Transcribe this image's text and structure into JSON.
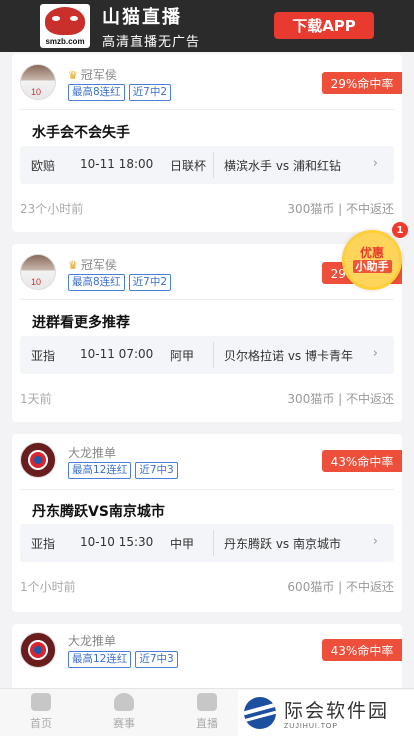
{
  "banner": {
    "logo_domain": "smzb.com",
    "title": "山猫直播",
    "subtitle": "高清直播无广告",
    "download_label": "下载APP"
  },
  "cards": [
    {
      "name": "冠军侯",
      "has_crown": true,
      "avatar": "player",
      "tags": [
        "最高8连红",
        "近7中2"
      ],
      "rate": "29%命中率",
      "title": "水手会不会失手",
      "match": {
        "type": "欧赔",
        "time": "10-11 18:00",
        "league": "日联杯",
        "teams": "横滨水手 vs 浦和红钻"
      },
      "ago": "23个小时前",
      "price": "300猫币 | 不中返还"
    },
    {
      "name": "冠军侯",
      "has_crown": true,
      "avatar": "player",
      "tags": [
        "最高8连红",
        "近7中2"
      ],
      "rate": "29%命中率",
      "title": "进群看更多推荐",
      "match": {
        "type": "亚指",
        "time": "10-11 07:00",
        "league": "阿甲",
        "teams": "贝尔格拉诺 vs 博卡青年"
      },
      "ago": "1天前",
      "price": "300猫币 | 不中返还"
    },
    {
      "name": "大龙推单",
      "has_crown": false,
      "avatar": "club",
      "tags": [
        "最高12连红",
        "近7中3"
      ],
      "rate": "43%命中率",
      "title": "丹东腾跃VS南京城市",
      "match": {
        "type": "亚指",
        "time": "10-10 15:30",
        "league": "中甲",
        "teams": "丹东腾跃 vs 南京城市"
      },
      "ago": "1个小时前",
      "price": "600猫币 | 不中返还"
    },
    {
      "name": "大龙推单",
      "has_crown": false,
      "avatar": "club",
      "tags": [
        "最高12连红",
        "近7中3"
      ],
      "rate": "43%命中率"
    }
  ],
  "promo": {
    "line1": "优惠",
    "line2": "小助手",
    "count": "1"
  },
  "nav": [
    {
      "label": "首页",
      "icon": "home-icon"
    },
    {
      "label": "赛事",
      "icon": "trophy-icon"
    },
    {
      "label": "直播",
      "icon": "play-icon"
    }
  ],
  "watermark": {
    "main": "际会软件园",
    "sub": "ZUJIHUI.TOP"
  },
  "icons": {
    "crown": "crown-icon",
    "arrow": "chevron-right-icon"
  },
  "colors": {
    "accent": "#ee4f3a",
    "tag_blue": "#3a6fd0",
    "banner_bg": "#2b2b2b"
  }
}
